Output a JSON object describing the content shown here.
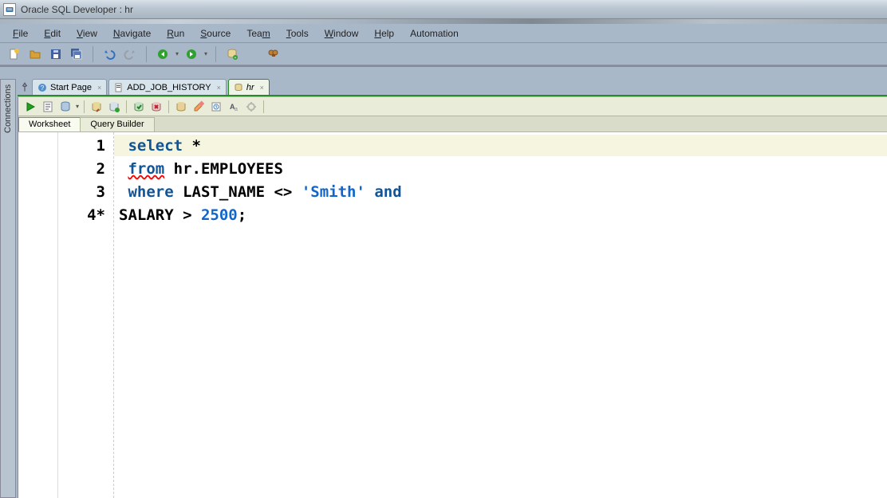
{
  "window": {
    "title": "Oracle SQL Developer : hr"
  },
  "menu": {
    "items": [
      "File",
      "Edit",
      "View",
      "Navigate",
      "Run",
      "Source",
      "Team",
      "Tools",
      "Window",
      "Help",
      "Automation"
    ]
  },
  "toolbar_main": {
    "icons": [
      "new-file",
      "open-folder",
      "save",
      "save-all",
      "undo",
      "redo",
      "back",
      "forward",
      "sql-icon",
      "binoculars"
    ]
  },
  "sidebar": {
    "label": "Connections"
  },
  "tabs": [
    {
      "icon": "question-icon",
      "label": "Start Page",
      "active": false
    },
    {
      "icon": "sql-file-icon",
      "label": "ADD_JOB_HISTORY",
      "active": false
    },
    {
      "icon": "sql-conn-icon",
      "label": "hr",
      "active": true
    }
  ],
  "editor_toolbar": {
    "icons": [
      "run",
      "explain",
      "autocommit",
      "script-export",
      "find-db",
      "commit",
      "rollback",
      "sql",
      "eraser",
      "clipboard",
      "case",
      "settings"
    ]
  },
  "sub_tabs": {
    "items": [
      "Worksheet",
      "Query Builder"
    ],
    "active": 0
  },
  "code": {
    "lines": [
      {
        "n": "1",
        "marker": "",
        "tokens": [
          {
            "t": " ",
            "c": ""
          },
          {
            "t": "select",
            "c": "kw"
          },
          {
            "t": " *",
            "c": ""
          }
        ]
      },
      {
        "n": "2",
        "marker": "",
        "tokens": [
          {
            "t": " ",
            "c": ""
          },
          {
            "t": "from",
            "c": "kw underline-red"
          },
          {
            "t": " hr.EMPLOYEES",
            "c": "id"
          }
        ]
      },
      {
        "n": "3",
        "marker": "",
        "tokens": [
          {
            "t": " ",
            "c": ""
          },
          {
            "t": "where",
            "c": "kw"
          },
          {
            "t": " LAST_NAME <> ",
            "c": "id"
          },
          {
            "t": "'Smith'",
            "c": "str"
          },
          {
            "t": " ",
            "c": ""
          },
          {
            "t": "and",
            "c": "kw"
          }
        ]
      },
      {
        "n": "4",
        "marker": "*",
        "tokens": [
          {
            "t": "SALARY > ",
            "c": "id"
          },
          {
            "t": "2500",
            "c": "num"
          },
          {
            "t": ";",
            "c": "id"
          }
        ]
      }
    ]
  }
}
